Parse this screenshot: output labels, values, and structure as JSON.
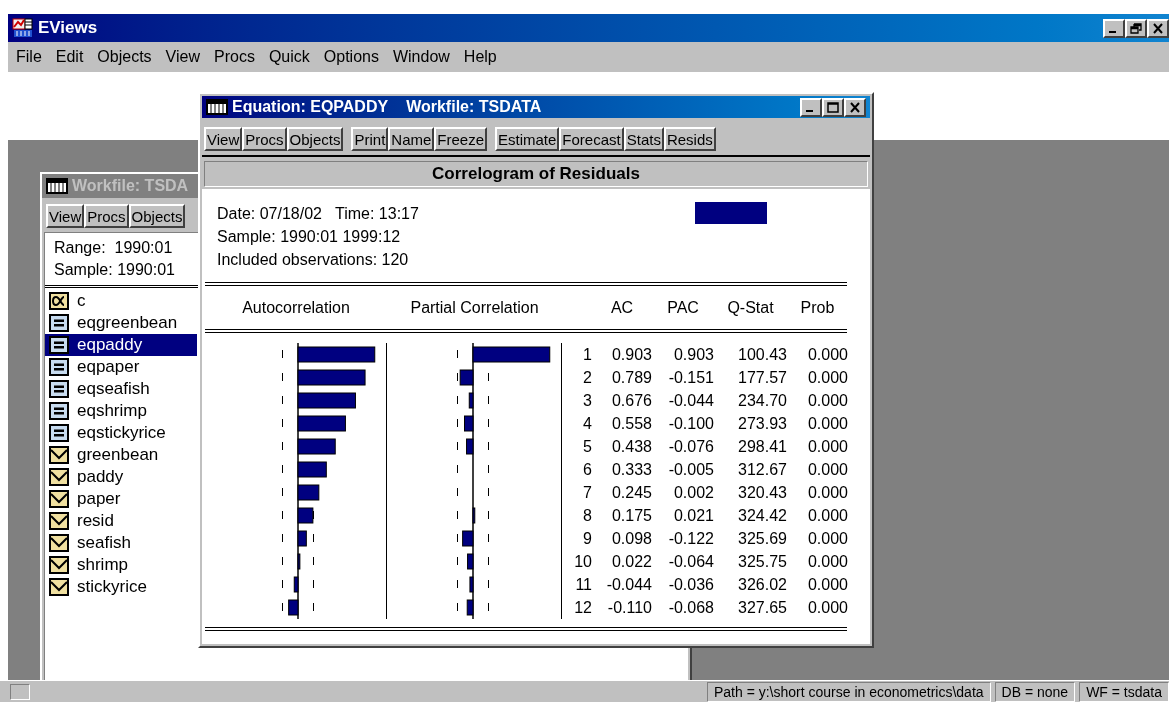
{
  "app": {
    "title": "EViews"
  },
  "menu": [
    "File",
    "Edit",
    "Objects",
    "View",
    "Procs",
    "Quick",
    "Options",
    "Window",
    "Help"
  ],
  "workfile_window": {
    "title": "Workfile: TSDA",
    "toolbar": [
      "View",
      "Procs",
      "Objects"
    ],
    "range": "Range:  1990:01",
    "sample": "Sample: 1990:01",
    "objects": [
      {
        "name": "c",
        "kind": "coef",
        "selected": false
      },
      {
        "name": "eqgreenbean",
        "kind": "equation",
        "selected": false
      },
      {
        "name": "eqpaddy",
        "kind": "equation",
        "selected": true
      },
      {
        "name": "eqpaper",
        "kind": "equation",
        "selected": false
      },
      {
        "name": "eqseafish",
        "kind": "equation",
        "selected": false
      },
      {
        "name": "eqshrimp",
        "kind": "equation",
        "selected": false
      },
      {
        "name": "eqstickyrice",
        "kind": "equation",
        "selected": false
      },
      {
        "name": "greenbean",
        "kind": "series",
        "selected": false
      },
      {
        "name": "paddy",
        "kind": "series",
        "selected": false
      },
      {
        "name": "paper",
        "kind": "series",
        "selected": false
      },
      {
        "name": "resid",
        "kind": "series",
        "selected": false
      },
      {
        "name": "seafish",
        "kind": "series",
        "selected": false
      },
      {
        "name": "shrimp",
        "kind": "series",
        "selected": false
      },
      {
        "name": "stickyrice",
        "kind": "series",
        "selected": false
      }
    ]
  },
  "equation_window": {
    "title": "Equation: EQPADDY",
    "workfile": "Workfile: TSDATA",
    "toolbar": [
      [
        "View",
        "Procs",
        "Objects"
      ],
      [
        "Print",
        "Name",
        "Freeze"
      ],
      [
        "Estimate",
        "Forecast",
        "Stats",
        "Resids"
      ]
    ],
    "heading": "Correlogram of Residuals",
    "info": [
      "Date: 07/18/02   Time: 13:17",
      "Sample: 1990:01 1999:12",
      "Included observations: 120"
    ],
    "columns": [
      "Autocorrelation",
      "Partial Correlation",
      "AC",
      "PAC",
      "Q-Stat",
      "Prob"
    ],
    "rows": [
      {
        "lag": "1",
        "ac": "0.903",
        "pac": "0.903",
        "q_stat": "100.43",
        "prob": "0.000"
      },
      {
        "lag": "2",
        "ac": "0.789",
        "pac": "-0.151",
        "q_stat": "177.57",
        "prob": "0.000"
      },
      {
        "lag": "3",
        "ac": "0.676",
        "pac": "-0.044",
        "q_stat": "234.70",
        "prob": "0.000"
      },
      {
        "lag": "4",
        "ac": "0.558",
        "pac": "-0.100",
        "q_stat": "273.93",
        "prob": "0.000"
      },
      {
        "lag": "5",
        "ac": "0.438",
        "pac": "-0.076",
        "q_stat": "298.41",
        "prob": "0.000"
      },
      {
        "lag": "6",
        "ac": "0.333",
        "pac": "-0.005",
        "q_stat": "312.67",
        "prob": "0.000"
      },
      {
        "lag": "7",
        "ac": "0.245",
        "pac": "0.002",
        "q_stat": "320.43",
        "prob": "0.000"
      },
      {
        "lag": "8",
        "ac": "0.175",
        "pac": "0.021",
        "q_stat": "324.42",
        "prob": "0.000"
      },
      {
        "lag": "9",
        "ac": "0.098",
        "pac": "-0.122",
        "q_stat": "325.69",
        "prob": "0.000"
      },
      {
        "lag": "10",
        "ac": "0.022",
        "pac": "-0.064",
        "q_stat": "325.75",
        "prob": "0.000"
      },
      {
        "lag": "11",
        "ac": "-0.044",
        "pac": "-0.036",
        "q_stat": "326.02",
        "prob": "0.000"
      },
      {
        "lag": "12",
        "ac": "-0.110",
        "pac": "-0.068",
        "q_stat": "327.65",
        "prob": "0.000"
      }
    ]
  },
  "status_bar": [
    "Path = y:\\short course in econometrics\\data",
    "DB = none",
    "WF = tsdata"
  ]
}
